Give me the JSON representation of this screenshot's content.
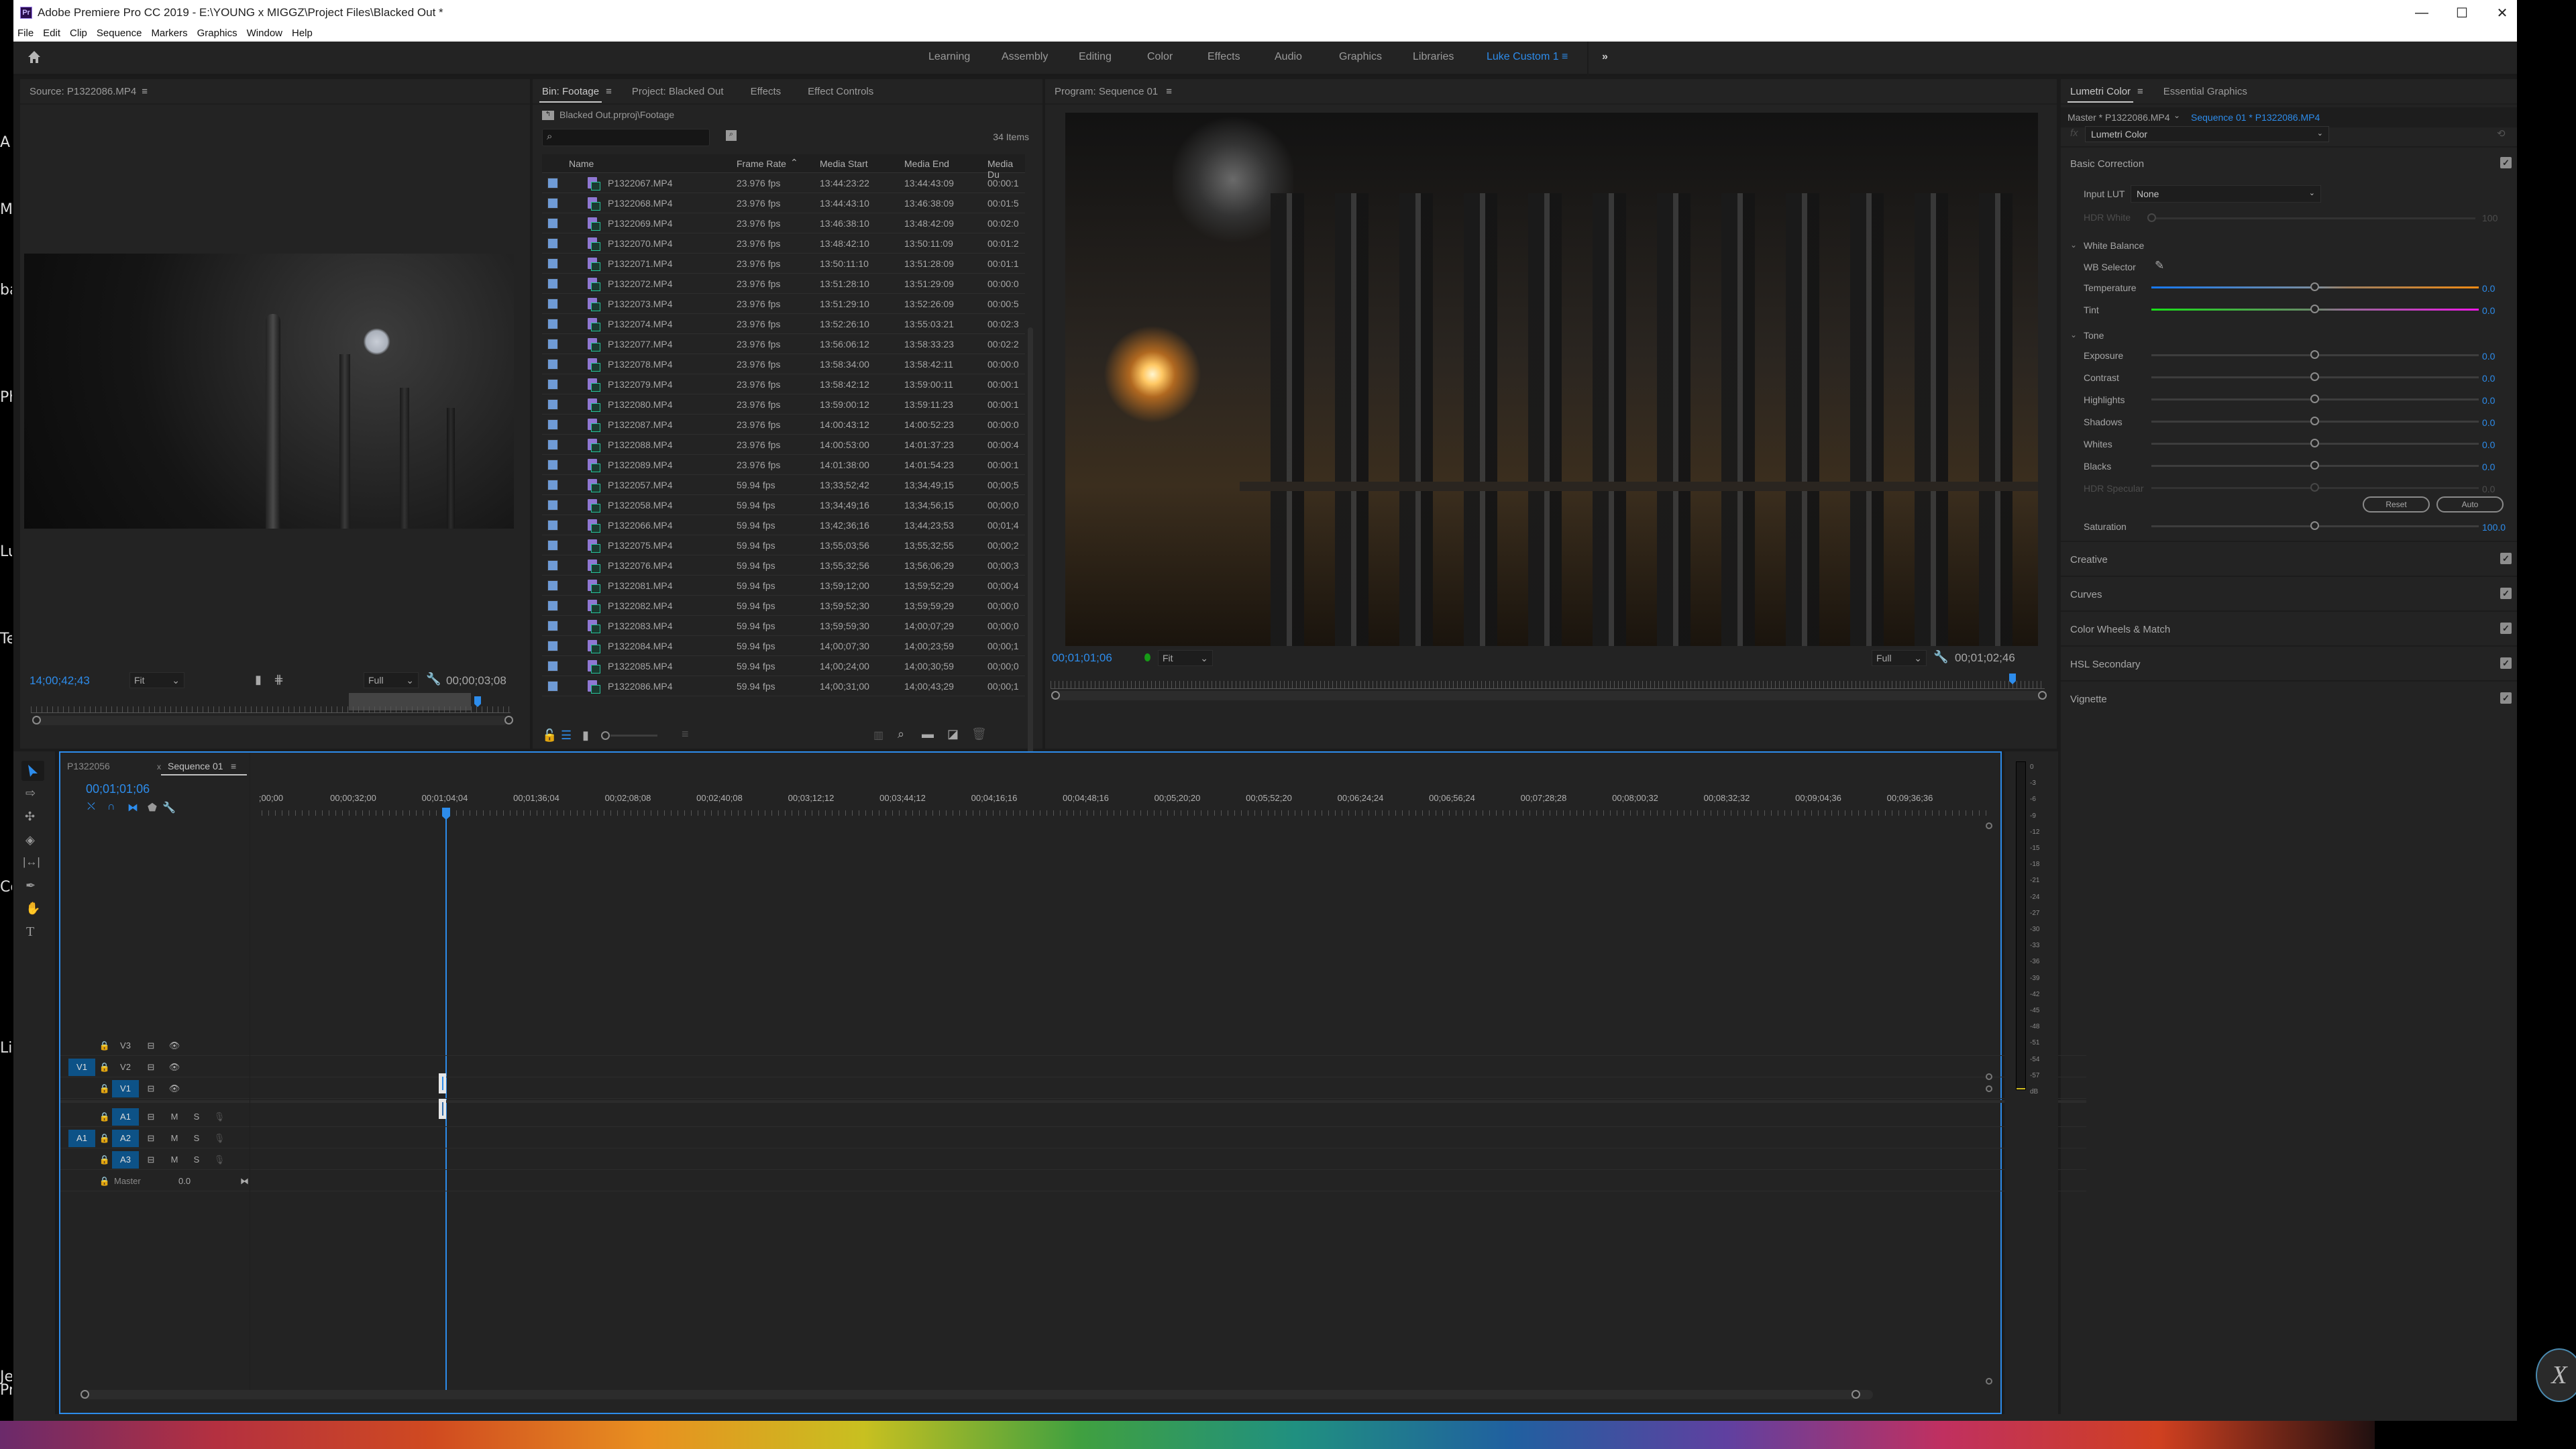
{
  "window": {
    "title": "Adobe Premiere Pro CC 2019 - E:\\YOUNG x MIGGZ\\Project Files\\Blacked Out *",
    "app_badge": "Pr",
    "controls": {
      "minimize": "—",
      "maximize": "☐",
      "close": "✕"
    }
  },
  "left_strip_labels": [
    "A",
    "M",
    "ba",
    "Ph",
    "Lu",
    "Te",
    "Cc",
    "Lic",
    "Je",
    "Pr"
  ],
  "menu": [
    "File",
    "Edit",
    "Clip",
    "Sequence",
    "Markers",
    "Graphics",
    "Window",
    "Help"
  ],
  "workspaces": {
    "tabs": [
      "Learning",
      "Assembly",
      "Editing",
      "Color",
      "Effects",
      "Audio",
      "Graphics",
      "Libraries",
      "Luke Custom 1"
    ],
    "active": "Luke Custom 1",
    "overflow": "»"
  },
  "source_monitor": {
    "title": "Source: P1322086.MP4",
    "timecode": "14;00;42;43",
    "zoom": "Fit",
    "resolution": "Full",
    "duration": "00;00;03;08"
  },
  "bin": {
    "tabs": [
      "Bin: Footage",
      "Project: Blacked Out",
      "Effects",
      "Effect Controls"
    ],
    "active_tab": "Bin: Footage",
    "path": "Blacked Out.prproj\\Footage",
    "search_placeholder": "",
    "item_count": "34 Items",
    "columns": [
      "Name",
      "Frame Rate",
      "Media Start",
      "Media End",
      "Media Du"
    ],
    "sort_column": "Frame Rate",
    "rows": [
      {
        "name": "P1322067.MP4",
        "fps": "23.976 fps",
        "start": "13:44:23:22",
        "end": "13:44:43:09",
        "dur": "00:00:1"
      },
      {
        "name": "P1322068.MP4",
        "fps": "23.976 fps",
        "start": "13:44:43:10",
        "end": "13:46:38:09",
        "dur": "00:01:5"
      },
      {
        "name": "P1322069.MP4",
        "fps": "23.976 fps",
        "start": "13:46:38:10",
        "end": "13:48:42:09",
        "dur": "00:02:0"
      },
      {
        "name": "P1322070.MP4",
        "fps": "23.976 fps",
        "start": "13:48:42:10",
        "end": "13:50:11:09",
        "dur": "00:01:2"
      },
      {
        "name": "P1322071.MP4",
        "fps": "23.976 fps",
        "start": "13:50:11:10",
        "end": "13:51:28:09",
        "dur": "00:01:1"
      },
      {
        "name": "P1322072.MP4",
        "fps": "23.976 fps",
        "start": "13:51:28:10",
        "end": "13:51:29:09",
        "dur": "00:00:0"
      },
      {
        "name": "P1322073.MP4",
        "fps": "23.976 fps",
        "start": "13:51:29:10",
        "end": "13:52:26:09",
        "dur": "00:00:5"
      },
      {
        "name": "P1322074.MP4",
        "fps": "23.976 fps",
        "start": "13:52:26:10",
        "end": "13:55:03:21",
        "dur": "00:02:3"
      },
      {
        "name": "P1322077.MP4",
        "fps": "23.976 fps",
        "start": "13:56:06:12",
        "end": "13:58:33:23",
        "dur": "00:02:2"
      },
      {
        "name": "P1322078.MP4",
        "fps": "23.976 fps",
        "start": "13:58:34:00",
        "end": "13:58:42:11",
        "dur": "00:00:0"
      },
      {
        "name": "P1322079.MP4",
        "fps": "23.976 fps",
        "start": "13:58:42:12",
        "end": "13:59:00:11",
        "dur": "00:00:1"
      },
      {
        "name": "P1322080.MP4",
        "fps": "23.976 fps",
        "start": "13:59:00:12",
        "end": "13:59:11:23",
        "dur": "00:00:1"
      },
      {
        "name": "P1322087.MP4",
        "fps": "23.976 fps",
        "start": "14:00:43:12",
        "end": "14:00:52:23",
        "dur": "00:00:0"
      },
      {
        "name": "P1322088.MP4",
        "fps": "23.976 fps",
        "start": "14:00:53:00",
        "end": "14:01:37:23",
        "dur": "00:00:4"
      },
      {
        "name": "P1322089.MP4",
        "fps": "23.976 fps",
        "start": "14:01:38:00",
        "end": "14:01:54:23",
        "dur": "00:00:1"
      },
      {
        "name": "P1322057.MP4",
        "fps": "59.94 fps",
        "start": "13;33;52;42",
        "end": "13;34;49;15",
        "dur": "00;00;5"
      },
      {
        "name": "P1322058.MP4",
        "fps": "59.94 fps",
        "start": "13;34;49;16",
        "end": "13;34;56;15",
        "dur": "00;00;0"
      },
      {
        "name": "P1322066.MP4",
        "fps": "59.94 fps",
        "start": "13;42;36;16",
        "end": "13;44;23;53",
        "dur": "00;01;4"
      },
      {
        "name": "P1322075.MP4",
        "fps": "59.94 fps",
        "start": "13;55;03;56",
        "end": "13;55;32;55",
        "dur": "00;00;2"
      },
      {
        "name": "P1322076.MP4",
        "fps": "59.94 fps",
        "start": "13;55;32;56",
        "end": "13;56;06;29",
        "dur": "00;00;3"
      },
      {
        "name": "P1322081.MP4",
        "fps": "59.94 fps",
        "start": "13;59;12;00",
        "end": "13;59;52;29",
        "dur": "00;00;4"
      },
      {
        "name": "P1322082.MP4",
        "fps": "59.94 fps",
        "start": "13;59;52;30",
        "end": "13;59;59;29",
        "dur": "00;00;0"
      },
      {
        "name": "P1322083.MP4",
        "fps": "59.94 fps",
        "start": "13;59;59;30",
        "end": "14;00;07;29",
        "dur": "00;00;0"
      },
      {
        "name": "P1322084.MP4",
        "fps": "59.94 fps",
        "start": "14;00;07;30",
        "end": "14;00;23;59",
        "dur": "00;00;1"
      },
      {
        "name": "P1322085.MP4",
        "fps": "59.94 fps",
        "start": "14;00;24;00",
        "end": "14;00;30;59",
        "dur": "00;00;0"
      },
      {
        "name": "P1322086.MP4",
        "fps": "59.94 fps",
        "start": "14;00;31;00",
        "end": "14;00;43;29",
        "dur": "00;00;1"
      }
    ]
  },
  "program_monitor": {
    "title": "Program: Sequence 01",
    "timecode": "00;01;01;06",
    "zoom": "Fit",
    "resolution": "Full",
    "duration": "00;01;02;46"
  },
  "lumetri": {
    "tabs": [
      "Lumetri Color",
      "Essential Graphics"
    ],
    "active_tab": "Lumetri Color",
    "master_clip": "Master * P1322086.MP4",
    "sequence_clip": "Sequence 01 * P1322086.MP4",
    "effect": "Lumetri Color",
    "fx_label": "fx",
    "basic_correction": {
      "title": "Basic Correction",
      "enabled": true,
      "input_lut_label": "Input LUT",
      "input_lut_value": "None",
      "hdr_white_label": "HDR White",
      "hdr_white_value": "100",
      "white_balance": {
        "title": "White Balance",
        "wb_selector_label": "WB Selector",
        "temperature": {
          "label": "Temperature",
          "value": "0.0",
          "position": 0.5
        },
        "tint": {
          "label": "Tint",
          "value": "0.0",
          "position": 0.5
        }
      },
      "tone": {
        "title": "Tone",
        "sliders": [
          {
            "label": "Exposure",
            "value": "0.0",
            "position": 0.5,
            "disabled": false
          },
          {
            "label": "Contrast",
            "value": "0.0",
            "position": 0.5,
            "disabled": false
          },
          {
            "label": "Highlights",
            "value": "0.0",
            "position": 0.5,
            "disabled": false
          },
          {
            "label": "Shadows",
            "value": "0.0",
            "position": 0.5,
            "disabled": false
          },
          {
            "label": "Whites",
            "value": "0.0",
            "position": 0.5,
            "disabled": false
          },
          {
            "label": "Blacks",
            "value": "0.0",
            "position": 0.5,
            "disabled": false
          },
          {
            "label": "HDR Specular",
            "value": "0.0",
            "position": 0.5,
            "disabled": true
          }
        ],
        "reset_label": "Reset",
        "auto_label": "Auto"
      },
      "saturation": {
        "label": "Saturation",
        "value": "100.0",
        "position": 0.5
      }
    },
    "sections": [
      {
        "title": "Creative",
        "enabled": true
      },
      {
        "title": "Curves",
        "enabled": true
      },
      {
        "title": "Color Wheels & Match",
        "enabled": true
      },
      {
        "title": "HSL Secondary",
        "enabled": true
      },
      {
        "title": "Vignette",
        "enabled": true
      }
    ]
  },
  "timeline": {
    "tabs": [
      "P1322056",
      "Sequence 01"
    ],
    "active_tab": "Sequence 01",
    "close_glyph": "x",
    "timecode": "00;01;01;06",
    "ruler_labels": [
      ";00;00",
      "00;00;32;00",
      "00;01;04;04",
      "00;01;36;04",
      "00;02;08;08",
      "00;02;40;08",
      "00;03;12;12",
      "00;03;44;12",
      "00;04;16;16",
      "00;04;48;16",
      "00;05;20;20",
      "00;05;52;20",
      "00;06;24;24",
      "00;06;56;24",
      "00;07;28;28",
      "00;08;00;32",
      "00;08;32;32",
      "00;09;04;36",
      "00;09;36;36"
    ],
    "video_tracks": [
      {
        "name": "V3",
        "source_patch": ""
      },
      {
        "name": "V2",
        "source_patch": "V1"
      },
      {
        "name": "V1",
        "source_patch": "",
        "targeted": true
      }
    ],
    "audio_tracks": [
      {
        "name": "A1",
        "source_patch": "",
        "targeted": true
      },
      {
        "name": "A2",
        "source_patch": "A1",
        "targeted": true
      },
      {
        "name": "A3",
        "source_patch": "",
        "targeted": true
      }
    ],
    "mute_label": "M",
    "solo_label": "S",
    "master_label": "Master",
    "master_value": "0.0"
  },
  "audio_meter": {
    "scale": [
      "0",
      "-3",
      "-6",
      "-9",
      "-12",
      "-15",
      "-18",
      "-21",
      "-24",
      "-27",
      "-30",
      "-33",
      "-36",
      "-39",
      "-42",
      "-45",
      "-48",
      "-51",
      "-54",
      "-57",
      "dB"
    ]
  },
  "colors": {
    "accent": "#2d8ceb",
    "panel_bg": "#232323",
    "track_target": "#0d5287",
    "clip_purple": "#8f77d3",
    "clip_green": "#27c29a",
    "lock_green": "#1fa31f"
  }
}
